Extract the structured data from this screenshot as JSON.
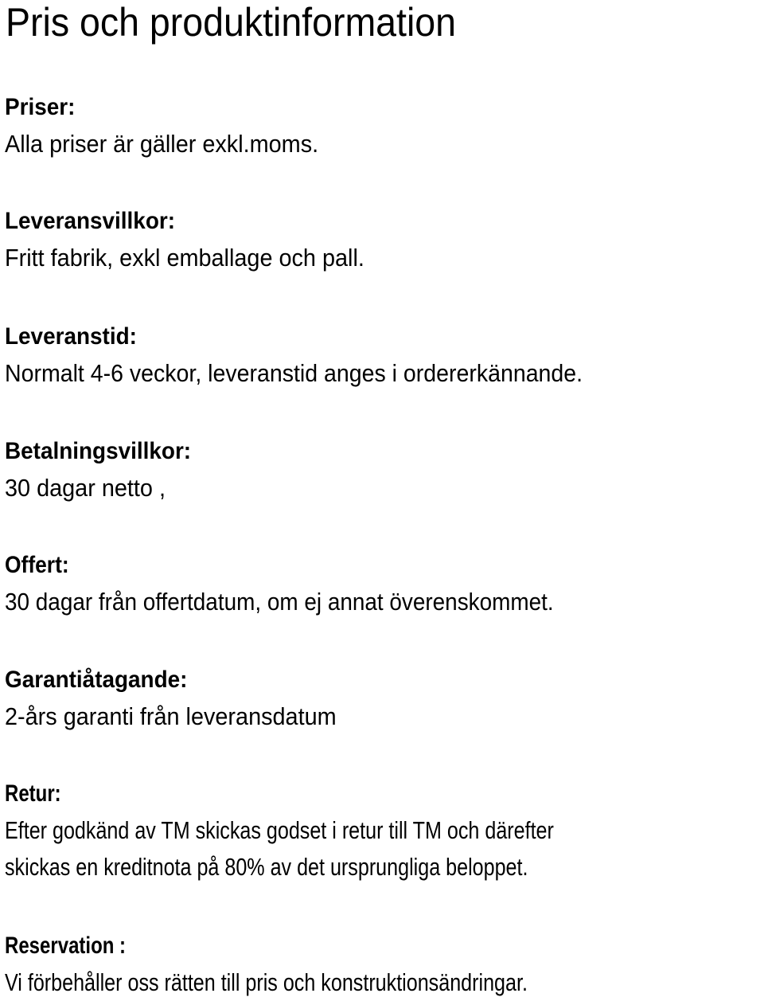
{
  "document": {
    "title": "Pris och produktinformation",
    "sections": [
      {
        "heading": "Priser:",
        "lines": [
          "Alla priser är gäller exkl.moms."
        ]
      },
      {
        "heading": "Leveransvillkor:",
        "lines": [
          "Fritt fabrik, exkl emballage och pall."
        ]
      },
      {
        "heading": "Leveranstid:",
        "lines": [
          "Normalt 4-6 veckor, leveranstid anges i ordererkännande."
        ]
      },
      {
        "heading": "Betalningsvillkor:",
        "lines": [
          "30 dagar netto ,"
        ]
      },
      {
        "heading": "Offert:",
        "lines": [
          "30 dagar från offertdatum, om ej annat överenskommet."
        ]
      },
      {
        "heading": "Garantiåtagande:",
        "lines": [
          "2-års garanti från leveransdatum"
        ]
      },
      {
        "heading": "Retur:",
        "lines": [
          "Efter godkänd av TM skickas godset i retur till TM och därefter",
          "skickas en kreditnota på 80% av det ursprungliga beloppet."
        ]
      },
      {
        "heading": "Reservation :",
        "lines": [
          "Vi förbehåller oss rätten till pris och konstruktionsändringar."
        ]
      }
    ]
  }
}
